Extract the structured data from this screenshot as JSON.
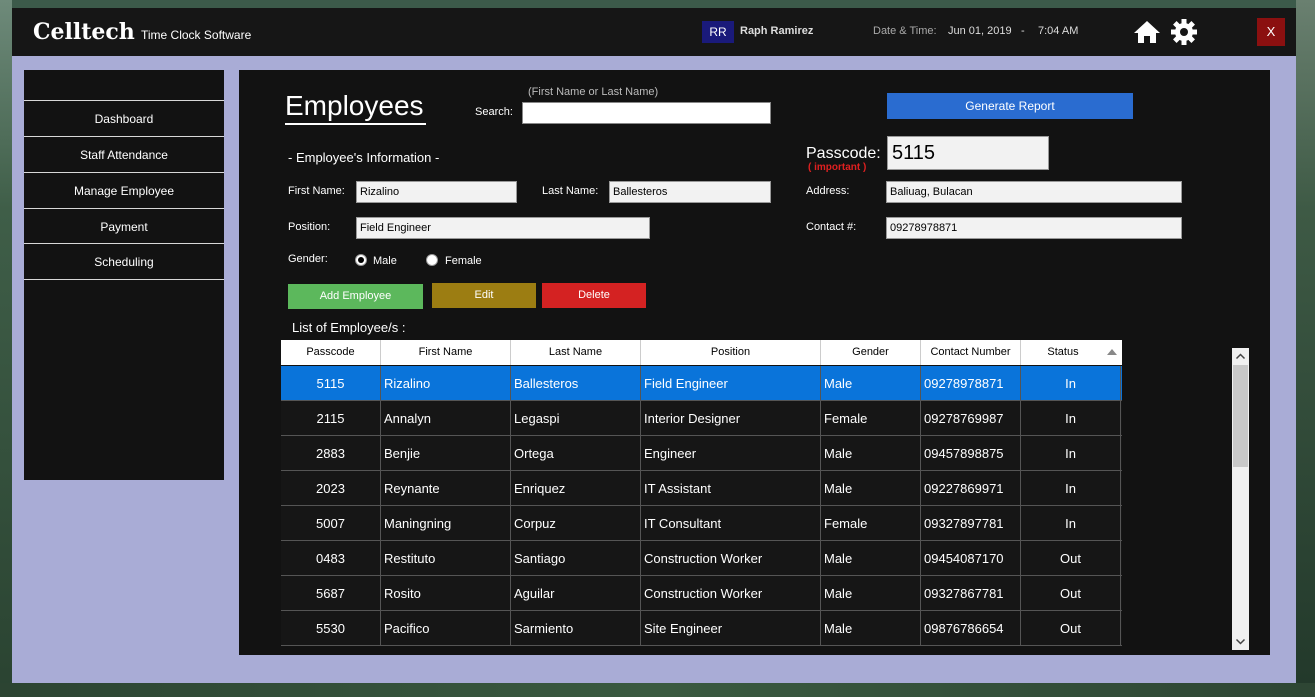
{
  "app": {
    "brand": "Celltech",
    "subtitle": "Time Clock Software",
    "user_initials": "RR",
    "user_name": "Raph Ramirez",
    "datetime_label": "Date & Time:",
    "date": "Jun 01, 2019",
    "separator": "-",
    "time": "7:04 AM",
    "close_label": "X"
  },
  "sidebar": {
    "items": [
      {
        "label": "Dashboard"
      },
      {
        "label": "Staff Attendance"
      },
      {
        "label": "Manage Employee"
      },
      {
        "label": "Payment"
      },
      {
        "label": "Scheduling"
      }
    ]
  },
  "main": {
    "title": "Employees",
    "search_hint": "(First Name or Last Name)",
    "search_label": "Search:",
    "search_value": "",
    "generate_report": "Generate Report",
    "section_title": "- Employee's Information -",
    "passcode_label": "Passcode:",
    "passcode_important": "( important )",
    "passcode_value": "5115",
    "first_name_label": "First Name:",
    "first_name_value": "Rizalino",
    "last_name_label": "Last Name:",
    "last_name_value": "Ballesteros",
    "address_label": "Address:",
    "address_value": "Baliuag, Bulacan",
    "position_label": "Position:",
    "position_value": "Field Engineer",
    "contact_label": "Contact #:",
    "contact_value": "09278978871",
    "gender_label": "Gender:",
    "gender_male": "Male",
    "gender_female": "Female",
    "gender_selected": "Male",
    "add_button": "Add Employee",
    "edit_button": "Edit",
    "delete_button": "Delete",
    "list_title": "List of Employee/s :"
  },
  "colors": {
    "add": "#5cb85c",
    "edit": "#9c7d12",
    "delete": "#d42222",
    "selected_row": "#0a74da"
  },
  "table": {
    "columns": [
      "Passcode",
      "First Name",
      "Last Name",
      "Position",
      "Gender",
      "Contact Number",
      "Status"
    ],
    "rows": [
      [
        "5115",
        "Rizalino",
        "Ballesteros",
        "Field Engineer",
        "Male",
        "09278978871",
        "In"
      ],
      [
        "2115",
        "Annalyn",
        "Legaspi",
        "Interior Designer",
        "Female",
        "09278769987",
        "In"
      ],
      [
        "2883",
        "Benjie",
        "Ortega",
        "Engineer",
        "Male",
        "09457898875",
        "In"
      ],
      [
        "2023",
        "Reynante",
        "Enriquez",
        "IT Assistant",
        "Male",
        "09227869971",
        "In"
      ],
      [
        "5007",
        "Maningning",
        "Corpuz",
        "IT Consultant",
        "Female",
        "09327897781",
        "In"
      ],
      [
        "0483",
        "Restituto",
        "Santiago",
        "Construction Worker",
        "Male",
        "09454087170",
        "Out"
      ],
      [
        "5687",
        "Rosito",
        "Aguilar",
        "Construction Worker",
        "Male",
        "09327867781",
        "Out"
      ],
      [
        "5530",
        "Pacifico",
        "Sarmiento",
        "Site Engineer",
        "Male",
        "09876786654",
        "Out"
      ]
    ],
    "selected_index": 0
  }
}
